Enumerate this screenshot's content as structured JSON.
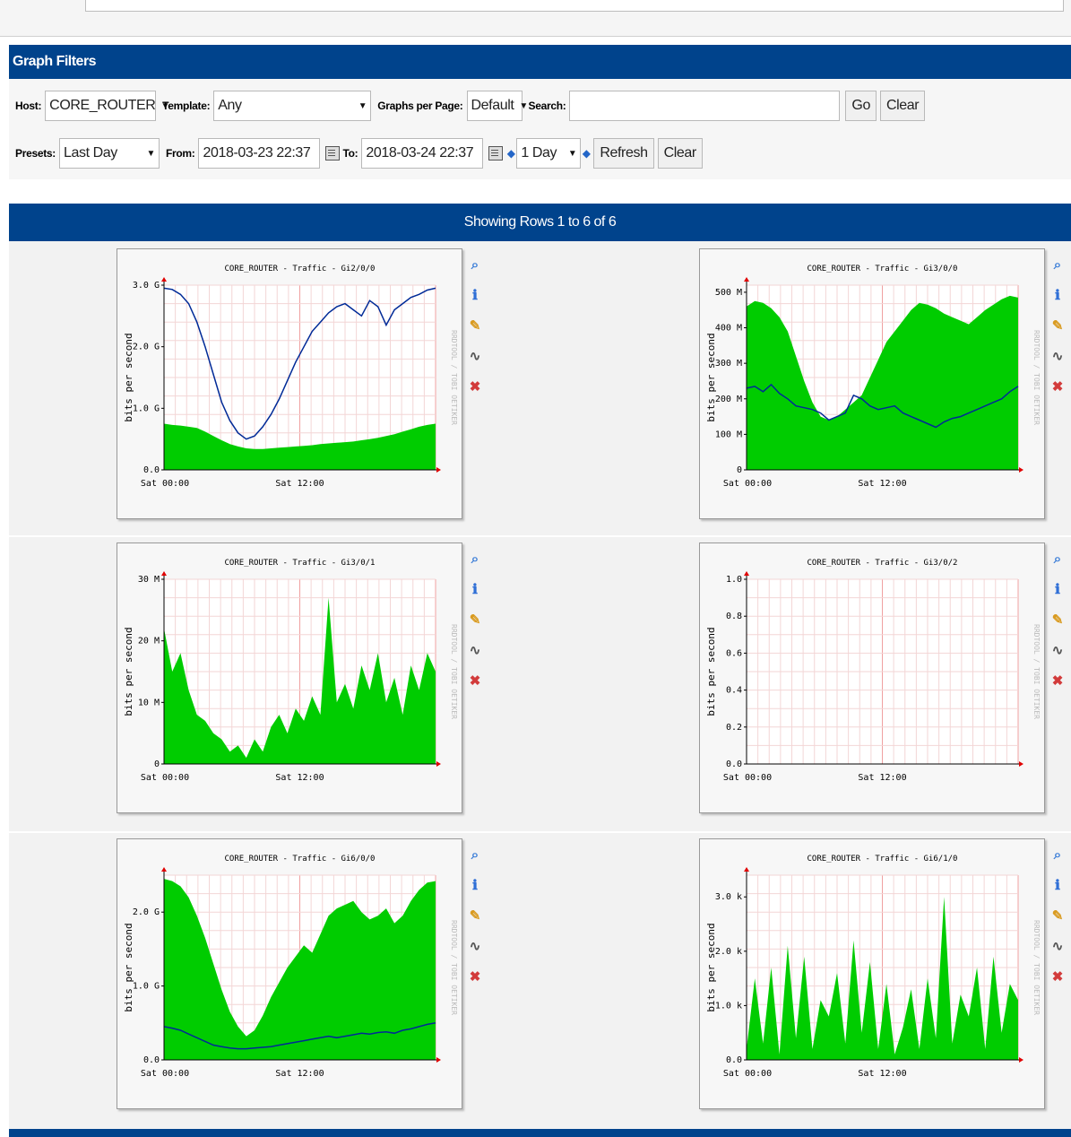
{
  "filters": {
    "title": "Graph Filters",
    "host_label": "Host:",
    "host_value": "CORE_ROUTER",
    "template_label": "Template:",
    "template_value": "Any",
    "graphs_per_page_label": "Graphs per Page:",
    "graphs_per_page_value": "Default",
    "search_label": "Search:",
    "search_value": "",
    "go_label": "Go",
    "clear_label": "Clear",
    "presets_label": "Presets:",
    "presets_value": "Last Day",
    "from_label": "From:",
    "from_value": "2018-03-23 22:37",
    "to_label": "To:",
    "to_value": "2018-03-24 22:37",
    "timespan_value": "1 Day",
    "refresh_label": "Refresh",
    "clear2_label": "Clear"
  },
  "showing": "Showing Rows 1 to 6 of 6",
  "colors": {
    "header": "#00438c",
    "area": "#00cc00",
    "line": "#002a97"
  },
  "icons": [
    "zoom-icon",
    "info-icon",
    "wrench-icon",
    "graph-edit-icon",
    "delete-icon"
  ],
  "charts": [
    {
      "title": "CORE_ROUTER - Traffic - Gi2/0/0",
      "ylabel": "bits per second",
      "watermark": "RRDTOOL / TOBI OETIKER",
      "yticks": [
        "0.0",
        "1.0 G",
        "2.0 G",
        "3.0 G"
      ],
      "ymax": 3.0,
      "xlabels": [
        "Sat 00:00",
        "Sat 12:00"
      ],
      "area": [
        0.75,
        0.73,
        0.72,
        0.7,
        0.68,
        0.62,
        0.55,
        0.48,
        0.42,
        0.38,
        0.35,
        0.34,
        0.34,
        0.35,
        0.36,
        0.37,
        0.38,
        0.39,
        0.4,
        0.42,
        0.43,
        0.44,
        0.45,
        0.46,
        0.48,
        0.5,
        0.52,
        0.55,
        0.58,
        0.62,
        0.66,
        0.7,
        0.73,
        0.75
      ],
      "line": [
        2.95,
        2.93,
        2.85,
        2.7,
        2.4,
        2.0,
        1.55,
        1.1,
        0.8,
        0.6,
        0.5,
        0.55,
        0.7,
        0.9,
        1.15,
        1.45,
        1.75,
        2.0,
        2.25,
        2.4,
        2.55,
        2.65,
        2.7,
        2.6,
        2.5,
        2.75,
        2.65,
        2.35,
        2.6,
        2.7,
        2.8,
        2.85,
        2.92,
        2.95
      ]
    },
    {
      "title": "CORE_ROUTER - Traffic - Gi3/0/0",
      "ylabel": "bits per second",
      "watermark": "RRDTOOL / TOBI OETIKER",
      "yticks": [
        "0",
        "100 M",
        "200 M",
        "300 M",
        "400 M",
        "500 M"
      ],
      "ymax": 520,
      "xlabels": [
        "Sat 00:00",
        "Sat 12:00"
      ],
      "area": [
        460,
        475,
        470,
        455,
        430,
        390,
        320,
        250,
        190,
        150,
        140,
        150,
        170,
        190,
        210,
        260,
        310,
        360,
        390,
        420,
        450,
        470,
        465,
        455,
        440,
        430,
        420,
        410,
        430,
        450,
        465,
        480,
        490,
        485
      ],
      "line": [
        230,
        235,
        220,
        240,
        215,
        200,
        180,
        175,
        170,
        160,
        140,
        150,
        160,
        210,
        200,
        180,
        170,
        175,
        180,
        160,
        150,
        140,
        130,
        120,
        135,
        145,
        150,
        160,
        170,
        180,
        190,
        200,
        220,
        235
      ]
    },
    {
      "title": "CORE_ROUTER - Traffic - Gi3/0/1",
      "ylabel": "bits per second",
      "watermark": "RRDTOOL / TOBI OETIKER",
      "yticks": [
        "0",
        "10 M",
        "20 M",
        "30 M"
      ],
      "ymax": 30,
      "xlabels": [
        "Sat 00:00",
        "Sat 12:00"
      ],
      "area": [
        22,
        15,
        18,
        12,
        8,
        7,
        5,
        4,
        2,
        3,
        1,
        4,
        2,
        6,
        8,
        5,
        9,
        7,
        11,
        8,
        27,
        10,
        13,
        9,
        16,
        12,
        18,
        10,
        14,
        8,
        16,
        12,
        18,
        15
      ],
      "line": []
    },
    {
      "title": "CORE_ROUTER - Traffic - Gi3/0/2",
      "ylabel": "bits per second",
      "watermark": "RRDTOOL / TOBI OETIKER",
      "yticks": [
        "0.0",
        "0.2",
        "0.4",
        "0.6",
        "0.8",
        "1.0"
      ],
      "ymax": 1.0,
      "xlabels": [
        "Sat 00:00",
        "Sat 12:00"
      ],
      "area": [],
      "line": []
    },
    {
      "title": "CORE_ROUTER - Traffic - Gi6/0/0",
      "ylabel": "bits per second",
      "watermark": "RRDTOOL / TOBI OETIKER",
      "yticks": [
        "0.0",
        "1.0 G",
        "2.0 G"
      ],
      "ymax": 2.5,
      "xlabels": [
        "Sat 00:00",
        "Sat 12:00"
      ],
      "area": [
        2.45,
        2.42,
        2.35,
        2.2,
        1.95,
        1.65,
        1.3,
        0.95,
        0.65,
        0.45,
        0.32,
        0.4,
        0.6,
        0.85,
        1.05,
        1.25,
        1.4,
        1.55,
        1.45,
        1.7,
        1.95,
        2.05,
        2.1,
        2.15,
        2.0,
        1.9,
        1.95,
        2.05,
        1.85,
        1.95,
        2.15,
        2.3,
        2.4,
        2.42
      ],
      "line": [
        0.45,
        0.43,
        0.4,
        0.35,
        0.3,
        0.25,
        0.2,
        0.18,
        0.16,
        0.15,
        0.15,
        0.16,
        0.17,
        0.18,
        0.2,
        0.22,
        0.24,
        0.26,
        0.28,
        0.3,
        0.32,
        0.3,
        0.32,
        0.34,
        0.36,
        0.35,
        0.37,
        0.38,
        0.36,
        0.4,
        0.42,
        0.45,
        0.48,
        0.5
      ]
    },
    {
      "title": "CORE_ROUTER - Traffic - Gi6/1/0",
      "ylabel": "bits per second",
      "watermark": "RRDTOOL / TOBI OETIKER",
      "yticks": [
        "0.0",
        "1.0 k",
        "2.0 k",
        "3.0 k"
      ],
      "ymax": 3.4,
      "xlabels": [
        "Sat 00:00",
        "Sat 12:00"
      ],
      "area": [
        0.2,
        1.5,
        0.3,
        1.7,
        0.1,
        2.1,
        0.4,
        1.9,
        0.2,
        1.1,
        0.8,
        1.6,
        0.3,
        2.2,
        0.5,
        1.8,
        0.2,
        1.4,
        0.1,
        0.6,
        1.3,
        0.2,
        1.5,
        0.4,
        3.0,
        0.3,
        1.2,
        0.8,
        1.7,
        0.2,
        1.9,
        0.5,
        1.4,
        1.1
      ],
      "line": []
    }
  ]
}
